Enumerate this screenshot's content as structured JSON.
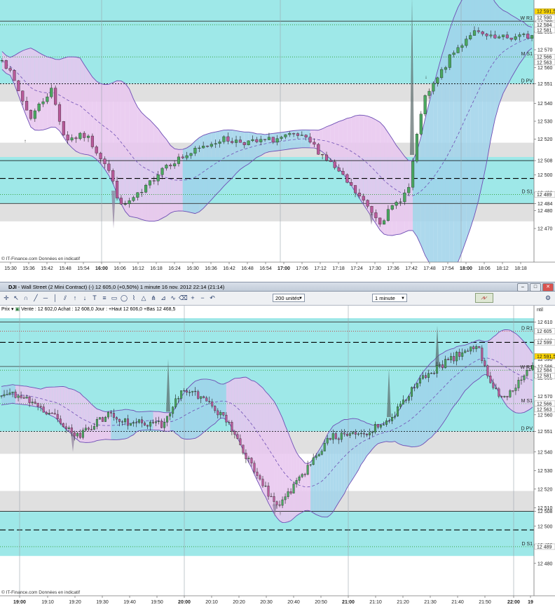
{
  "toolbar": {
    "title_symbol": "DJI",
    "title_rest": "- Wall Street (2 Mini Contract) (-)   12 605,0 (+0,50%)   1 minute   16 nov. 2012 22:14 (21:14)",
    "units_select": "200 unités",
    "interval_select": "1 minute"
  },
  "infobar": {
    "prix": "Prix",
    "quote": "Vente : 12 602,0  Achat : 12 608,0  Jour : +Haut 12 606,0 +Bas 12 468,5"
  },
  "colors": {
    "cyan_zone": "#9ee8e8",
    "grey_zone": "#e0e0e0",
    "blue_band": "#9fd2ea",
    "pink_band": "#e8c6ef",
    "candle_up": "#4aa860",
    "candle_down": "#b85a9a"
  },
  "top_chart": {
    "watermark": "© IT-Finance.com  Données en indicatif",
    "y_ticks": [
      "12 586",
      "12 580",
      "12 570",
      "12 560",
      "12 551",
      "12 540",
      "12 530",
      "12 520",
      "12 508",
      "12 500",
      "12 490",
      "12 484",
      "12 480",
      "12 470"
    ],
    "price_tags": [
      {
        "text": "12 591,5",
        "bg": "#ffd800"
      },
      {
        "text": "12 590",
        "bg": "#ffffff"
      },
      {
        "text": "12 584",
        "bg": "#ffffff"
      },
      {
        "text": "12 581",
        "bg": "#ffffff"
      },
      {
        "text": "12 566",
        "bg": "#ffffff"
      },
      {
        "text": "12 563",
        "bg": "#ffffff"
      },
      {
        "text": "12 489",
        "bg": "#ffffff"
      }
    ],
    "level_labels": [
      "W R1",
      "M S1",
      "D PV",
      "D S1"
    ],
    "x_ticks": [
      {
        "t": "15:30",
        "b": false
      },
      {
        "t": "15:36",
        "b": false
      },
      {
        "t": "15:42",
        "b": false
      },
      {
        "t": "15:48",
        "b": false
      },
      {
        "t": "15:54",
        "b": false
      },
      {
        "t": "16:00",
        "b": true
      },
      {
        "t": "16:06",
        "b": false
      },
      {
        "t": "16:12",
        "b": false
      },
      {
        "t": "16:18",
        "b": false
      },
      {
        "t": "16:24",
        "b": false
      },
      {
        "t": "16:30",
        "b": false
      },
      {
        "t": "16:36",
        "b": false
      },
      {
        "t": "16:42",
        "b": false
      },
      {
        "t": "16:48",
        "b": false
      },
      {
        "t": "16:54",
        "b": false
      },
      {
        "t": "17:00",
        "b": true
      },
      {
        "t": "17:06",
        "b": false
      },
      {
        "t": "17:12",
        "b": false
      },
      {
        "t": "17:18",
        "b": false
      },
      {
        "t": "17:24",
        "b": false
      },
      {
        "t": "17:30",
        "b": false
      },
      {
        "t": "17:36",
        "b": false
      },
      {
        "t": "17:42",
        "b": false
      },
      {
        "t": "17:48",
        "b": false
      },
      {
        "t": "17:54",
        "b": false
      },
      {
        "t": "18:00",
        "b": true
      },
      {
        "t": "18:06",
        "b": false
      },
      {
        "t": "18:12",
        "b": false
      },
      {
        "t": "18:18",
        "b": false
      }
    ]
  },
  "bottom_chart": {
    "watermark": "© IT-Finance.com  Données en indicatif",
    "right_header": "ntil",
    "y_ticks": [
      "12 610",
      "12 600",
      "12 590",
      "12 586",
      "12 580",
      "12 570",
      "12 560",
      "12 551",
      "12 540",
      "12 530",
      "12 520",
      "12 510",
      "12 508",
      "12 500",
      "12 490",
      "12 480"
    ],
    "price_tags": [
      {
        "text": "12 605",
        "bg": "#ffffff"
      },
      {
        "text": "12 599",
        "bg": "#ffffff"
      },
      {
        "text": "12 591,5",
        "bg": "#ffd800"
      },
      {
        "text": "12 584",
        "bg": "#ffffff"
      },
      {
        "text": "12 581",
        "bg": "#ffffff"
      },
      {
        "text": "12 566",
        "bg": "#ffffff"
      },
      {
        "text": "12 563",
        "bg": "#ffffff"
      },
      {
        "text": "12 489",
        "bg": "#ffffff"
      }
    ],
    "level_labels": [
      "D R1",
      "W R1",
      "M S1",
      "D PV",
      "D S1"
    ],
    "x_ticks": [
      {
        "t": "19:00",
        "b": true
      },
      {
        "t": "19:10",
        "b": false
      },
      {
        "t": "19:20",
        "b": false
      },
      {
        "t": "19:30",
        "b": false
      },
      {
        "t": "19:40",
        "b": false
      },
      {
        "t": "19:50",
        "b": false
      },
      {
        "t": "20:00",
        "b": true
      },
      {
        "t": "20:10",
        "b": false
      },
      {
        "t": "20:20",
        "b": false
      },
      {
        "t": "20:30",
        "b": false
      },
      {
        "t": "20:40",
        "b": false
      },
      {
        "t": "20:50",
        "b": false
      },
      {
        "t": "21:00",
        "b": true
      },
      {
        "t": "21:10",
        "b": false
      },
      {
        "t": "21:20",
        "b": false
      },
      {
        "t": "21:30",
        "b": false
      },
      {
        "t": "21:40",
        "b": false
      },
      {
        "t": "21:50",
        "b": false
      },
      {
        "t": "22:00",
        "b": true
      },
      {
        "t": "19",
        "b": true
      }
    ]
  }
}
